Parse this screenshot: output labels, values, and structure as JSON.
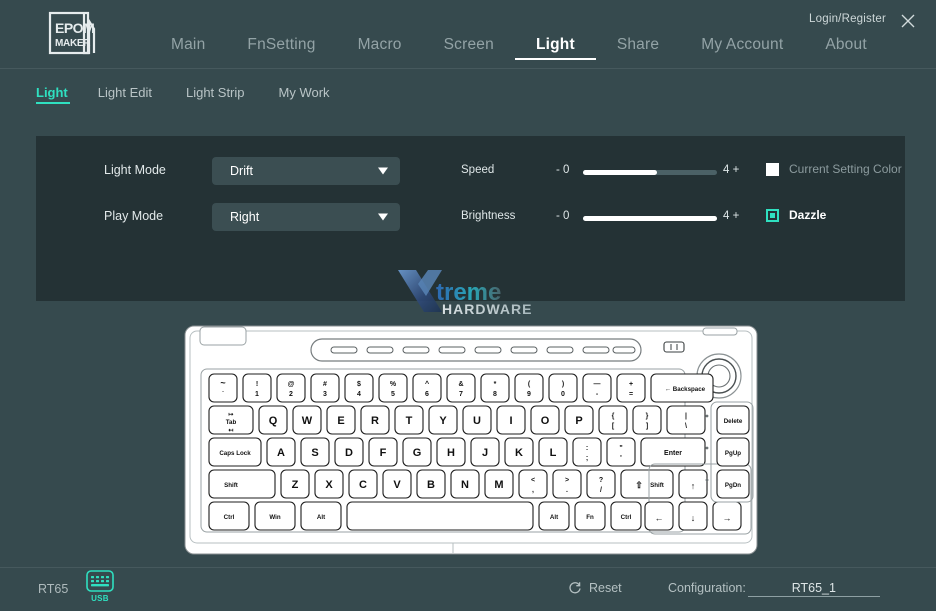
{
  "window": {
    "logo_text_top": "EPOM",
    "logo_text_bottom": "MAKER",
    "login_register": "Login/Register",
    "close_icon": "close-icon"
  },
  "mainnav": {
    "items": [
      {
        "label": "Main",
        "active": false
      },
      {
        "label": "FnSetting",
        "active": false
      },
      {
        "label": "Macro",
        "active": false
      },
      {
        "label": "Screen",
        "active": false
      },
      {
        "label": "Light",
        "active": true
      },
      {
        "label": "Share",
        "active": false
      },
      {
        "label": "My Account",
        "active": false
      },
      {
        "label": "About",
        "active": false
      }
    ]
  },
  "subtabs": {
    "items": [
      {
        "label": "Light",
        "active": true
      },
      {
        "label": "Light Edit",
        "active": false
      },
      {
        "label": "Light Strip",
        "active": false
      },
      {
        "label": "My Work",
        "active": false
      }
    ]
  },
  "panel": {
    "light_mode": {
      "label": "Light Mode",
      "value": "Drift",
      "arrow_icon": "chevron-down-icon"
    },
    "play_mode": {
      "label": "Play Mode",
      "value": "Right",
      "arrow_icon": "chevron-down-icon"
    },
    "speed": {
      "label": "Speed",
      "min_label": "- 0",
      "max_label": "4 +",
      "fill_percent": 55
    },
    "brightness": {
      "label": "Brightness",
      "min_label": "- 0",
      "max_label": "4 +",
      "fill_percent": 100
    },
    "current_setting_color": {
      "label": "Current Setting Color",
      "checked": false
    },
    "dazzle": {
      "label": "Dazzle",
      "checked": true
    }
  },
  "watermark": {
    "text_main": "treme",
    "text_sub": "HARDWARE",
    "mark": "x-logo"
  },
  "statusbar": {
    "device_name": "RT65",
    "device_icon": "keyboard-icon",
    "connection": "USB",
    "reset_label": "Reset",
    "reset_icon": "refresh-icon",
    "configuration_label": "Configuration:",
    "configuration_value": "RT65_1"
  },
  "colors": {
    "page_bg": "#364a4e",
    "panel_bg": "#243235",
    "accent": "#2fe0c0",
    "dropdown_bg": "#3b4e52",
    "muted_text": "#93a3a6"
  },
  "keyboard": {
    "rows": {
      "row_fn": [
        "",
        "",
        "",
        "",
        "",
        "",
        "",
        "",
        ""
      ],
      "row_num": [
        {
          "top": "~",
          "bottom": "`"
        },
        {
          "top": "!",
          "bottom": "1"
        },
        {
          "top": "@",
          "bottom": "2"
        },
        {
          "top": "#",
          "bottom": "3"
        },
        {
          "top": "$",
          "bottom": "4"
        },
        {
          "top": "%",
          "bottom": "5"
        },
        {
          "top": "^",
          "bottom": "6"
        },
        {
          "top": "&",
          "bottom": "7"
        },
        {
          "top": "*",
          "bottom": "8"
        },
        {
          "top": "(",
          "bottom": "9"
        },
        {
          "top": ")",
          "bottom": "0"
        },
        {
          "top": "—",
          "bottom": "-"
        },
        {
          "top": "+",
          "bottom": "="
        }
      ],
      "backspace": "Backspace",
      "row_q": [
        "Q",
        "W",
        "E",
        "R",
        "T",
        "Y",
        "U",
        "I",
        "O",
        "P"
      ],
      "row_q_extra": [
        {
          "top": "{",
          "bottom": "["
        },
        {
          "top": "}",
          "bottom": "]"
        },
        {
          "top": "|",
          "bottom": "\\"
        }
      ],
      "tab": "Tab",
      "row_a": [
        "A",
        "S",
        "D",
        "F",
        "G",
        "H",
        "J",
        "K",
        "L"
      ],
      "row_a_extra": [
        {
          "top": ":",
          "bottom": ";"
        },
        {
          "top": "\"",
          "bottom": "'"
        }
      ],
      "caps_lock": "Caps Lock",
      "enter": "Enter",
      "row_z": [
        "Z",
        "X",
        "C",
        "V",
        "B",
        "N",
        "M"
      ],
      "row_z_extra": [
        {
          "top": "<",
          "bottom": ","
        },
        {
          "top": ">",
          "bottom": "."
        },
        {
          "top": "?",
          "bottom": "/"
        }
      ],
      "shift_left": "Shift",
      "shift_right": "Shift",
      "row_bottom": [
        "Ctrl",
        "Win",
        "Alt"
      ],
      "row_bottom_right": [
        "Alt",
        "Fn",
        "Ctrl"
      ],
      "space": "",
      "right_column": [
        "Delete",
        "PgUp",
        "PgDn"
      ],
      "arrows": {
        "up": "↑",
        "left": "←",
        "down": "↓",
        "right": "→"
      }
    }
  }
}
